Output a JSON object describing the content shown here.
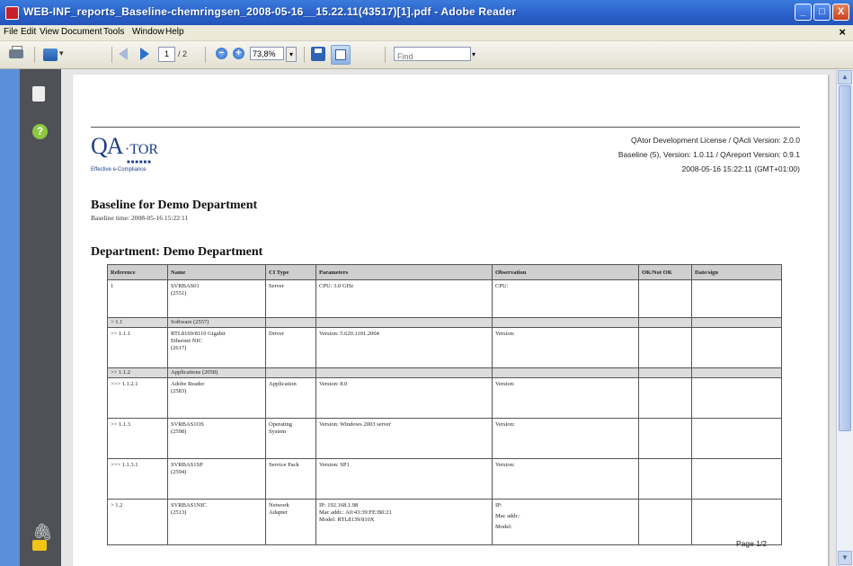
{
  "window": {
    "title": "WEB-INF_reports_Baseline-chemringsen_2008-05-16__15.22.11(43517)[1].pdf - Adobe Reader",
    "minimize": "_",
    "maximize": "□",
    "close": "X"
  },
  "menu": {
    "items": [
      "File",
      "Edit",
      "View",
      "Document",
      "Tools",
      "Window",
      "Help"
    ],
    "close": "×"
  },
  "toolbar": {
    "page_current": "1",
    "page_total": "/ 2",
    "zoom": "73,8%",
    "zoom_dropdown": "▾",
    "find_placeholder": "Find",
    "find_dropdown": "▾",
    "cam_dropdown": "▾"
  },
  "sidebar": {
    "pages_icon": "pages-icon",
    "help_icon": "help-icon",
    "help_glyph": "?",
    "attachments_icon": "paperclip-icon",
    "attachments_glyph": "🖇",
    "comments_icon": "comments-icon"
  },
  "document": {
    "logo": {
      "qa": "QA",
      "tor": "·TOR",
      "dots": "■■■■■■",
      "tagline": "Effective e-Compliance"
    },
    "header_right": [
      "QAtor Development License / QAcli Version: 2.0.0",
      "Baseline (5), Version: 1.0.11 / QAreport Version: 0.9.1",
      "2008-05-16  15:22:11 (GMT+01:00)"
    ],
    "title": "Baseline for Demo Department",
    "baseline_time": "Baseline time: 2008-05-16  15:22:11",
    "department_heading": "Department: Demo Department",
    "footer": "Page 1/2",
    "table": {
      "headers": [
        "Reference",
        "Name",
        "CI Type",
        "Parameters",
        "Observation",
        "OK/Not OK",
        "Date/sign"
      ],
      "rows": [
        {
          "kind": "item",
          "ref": "1",
          "name": [
            "SVRBAS01",
            "(2551)"
          ],
          "type": [
            "Server"
          ],
          "params": [
            "CPU: 3.0 GHz"
          ],
          "obs": [
            "CPU:"
          ]
        },
        {
          "kind": "sub",
          "ref": "> 1.1",
          "label": "Software (2557)"
        },
        {
          "kind": "item",
          "ref": ">> 1.1.1",
          "name": [
            "RTL8169/8110 Gigabit",
            "Ethernet NIC",
            "(2617)"
          ],
          "type": [
            "Driver"
          ],
          "params": [
            "Version: 5.620.1101.2004"
          ],
          "obs": [
            "Version:"
          ]
        },
        {
          "kind": "sub",
          "ref": ">> 1.1.2",
          "label": "Applications (2058)"
        },
        {
          "kind": "item",
          "ref": ">>> 1.1.2.1",
          "name": [
            "Adobe Reader",
            "(2583)"
          ],
          "type": [
            "Application"
          ],
          "params": [
            "Version: 8.0"
          ],
          "obs": [
            "Version:"
          ]
        },
        {
          "kind": "item",
          "ref": ">> 1.1.3",
          "name": [
            "SVRBAS1OS",
            "(2598)"
          ],
          "type": [
            "Operating",
            "System"
          ],
          "params": [
            "Version: Windows 2003 server"
          ],
          "obs": [
            "Version:"
          ]
        },
        {
          "kind": "item",
          "ref": ">>> 1.1.3.1",
          "name": [
            "SVRBAS1SP",
            "(2594)"
          ],
          "type": [
            "Service Pack"
          ],
          "params": [
            "Version: SP1"
          ],
          "obs": [
            "Version:"
          ]
        },
        {
          "kind": "item",
          "ref": "> 1.2",
          "name": [
            "SVRBAS1NIC",
            "(2513)"
          ],
          "type": [
            "Network",
            "Adapter"
          ],
          "params": [
            "IP: 192.168.1.98",
            "Mac addr.: A0:43:39:FE:B0:21",
            "Model: RTL8139/810X"
          ],
          "obs": [
            "IP:",
            "Mac addr.:",
            "Model:"
          ]
        }
      ]
    }
  },
  "colors": {
    "titlebar": "#2a5fc8",
    "sidebar": "#4f5157",
    "viewer_bg": "#e6e6e6",
    "logo_blue": "#1e3d8a"
  }
}
